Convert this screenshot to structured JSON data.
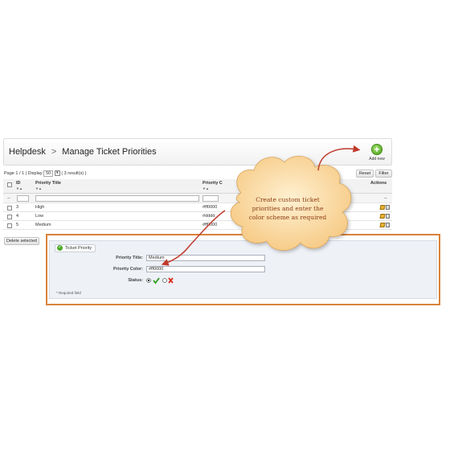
{
  "header": {
    "breadcrumb_root": "Helpdesk",
    "separator": ">",
    "title": "Manage Ticket Priorities"
  },
  "add_new": {
    "icon": "plus-circle-icon",
    "label": "Add new"
  },
  "pager": {
    "page_label": "Page 1 / 1 | Display",
    "display_value": "50",
    "results": "( 3 result(s) )"
  },
  "toolbar": {
    "reset_label": "Reset",
    "filter_label": "Filter"
  },
  "grid": {
    "columns": {
      "id": "ID",
      "priority_title": "Priority Title",
      "priority_color": "Priority C",
      "actions": "Actions"
    },
    "filter_dash": "--",
    "rows": [
      {
        "id": "3",
        "title": "High",
        "color": "#ff0000"
      },
      {
        "id": "4",
        "title": "Low",
        "color": "#dddd"
      },
      {
        "id": "5",
        "title": "Medium",
        "color": "#ff0000"
      }
    ],
    "delete_selected_label": "Delete selected"
  },
  "form": {
    "legend": "Ticket Priority",
    "priority_title_label": "Priority Title:",
    "priority_title_value": "Medium",
    "priority_color_label": "Priority Color:",
    "priority_color_value": "#ff0000",
    "status_label": "Status:",
    "required_note": "* Required field"
  },
  "callout": {
    "text": "Create custom ticket priorities and enter the color scheme as required",
    "fill_color": "#fdd9a0",
    "arrow_color": "#c0392b"
  },
  "colors": {
    "accent_orange": "#d9823a",
    "add_green": "#4b9c1a",
    "status_ok": "#2e9e1d",
    "status_no": "#d62c1a"
  }
}
